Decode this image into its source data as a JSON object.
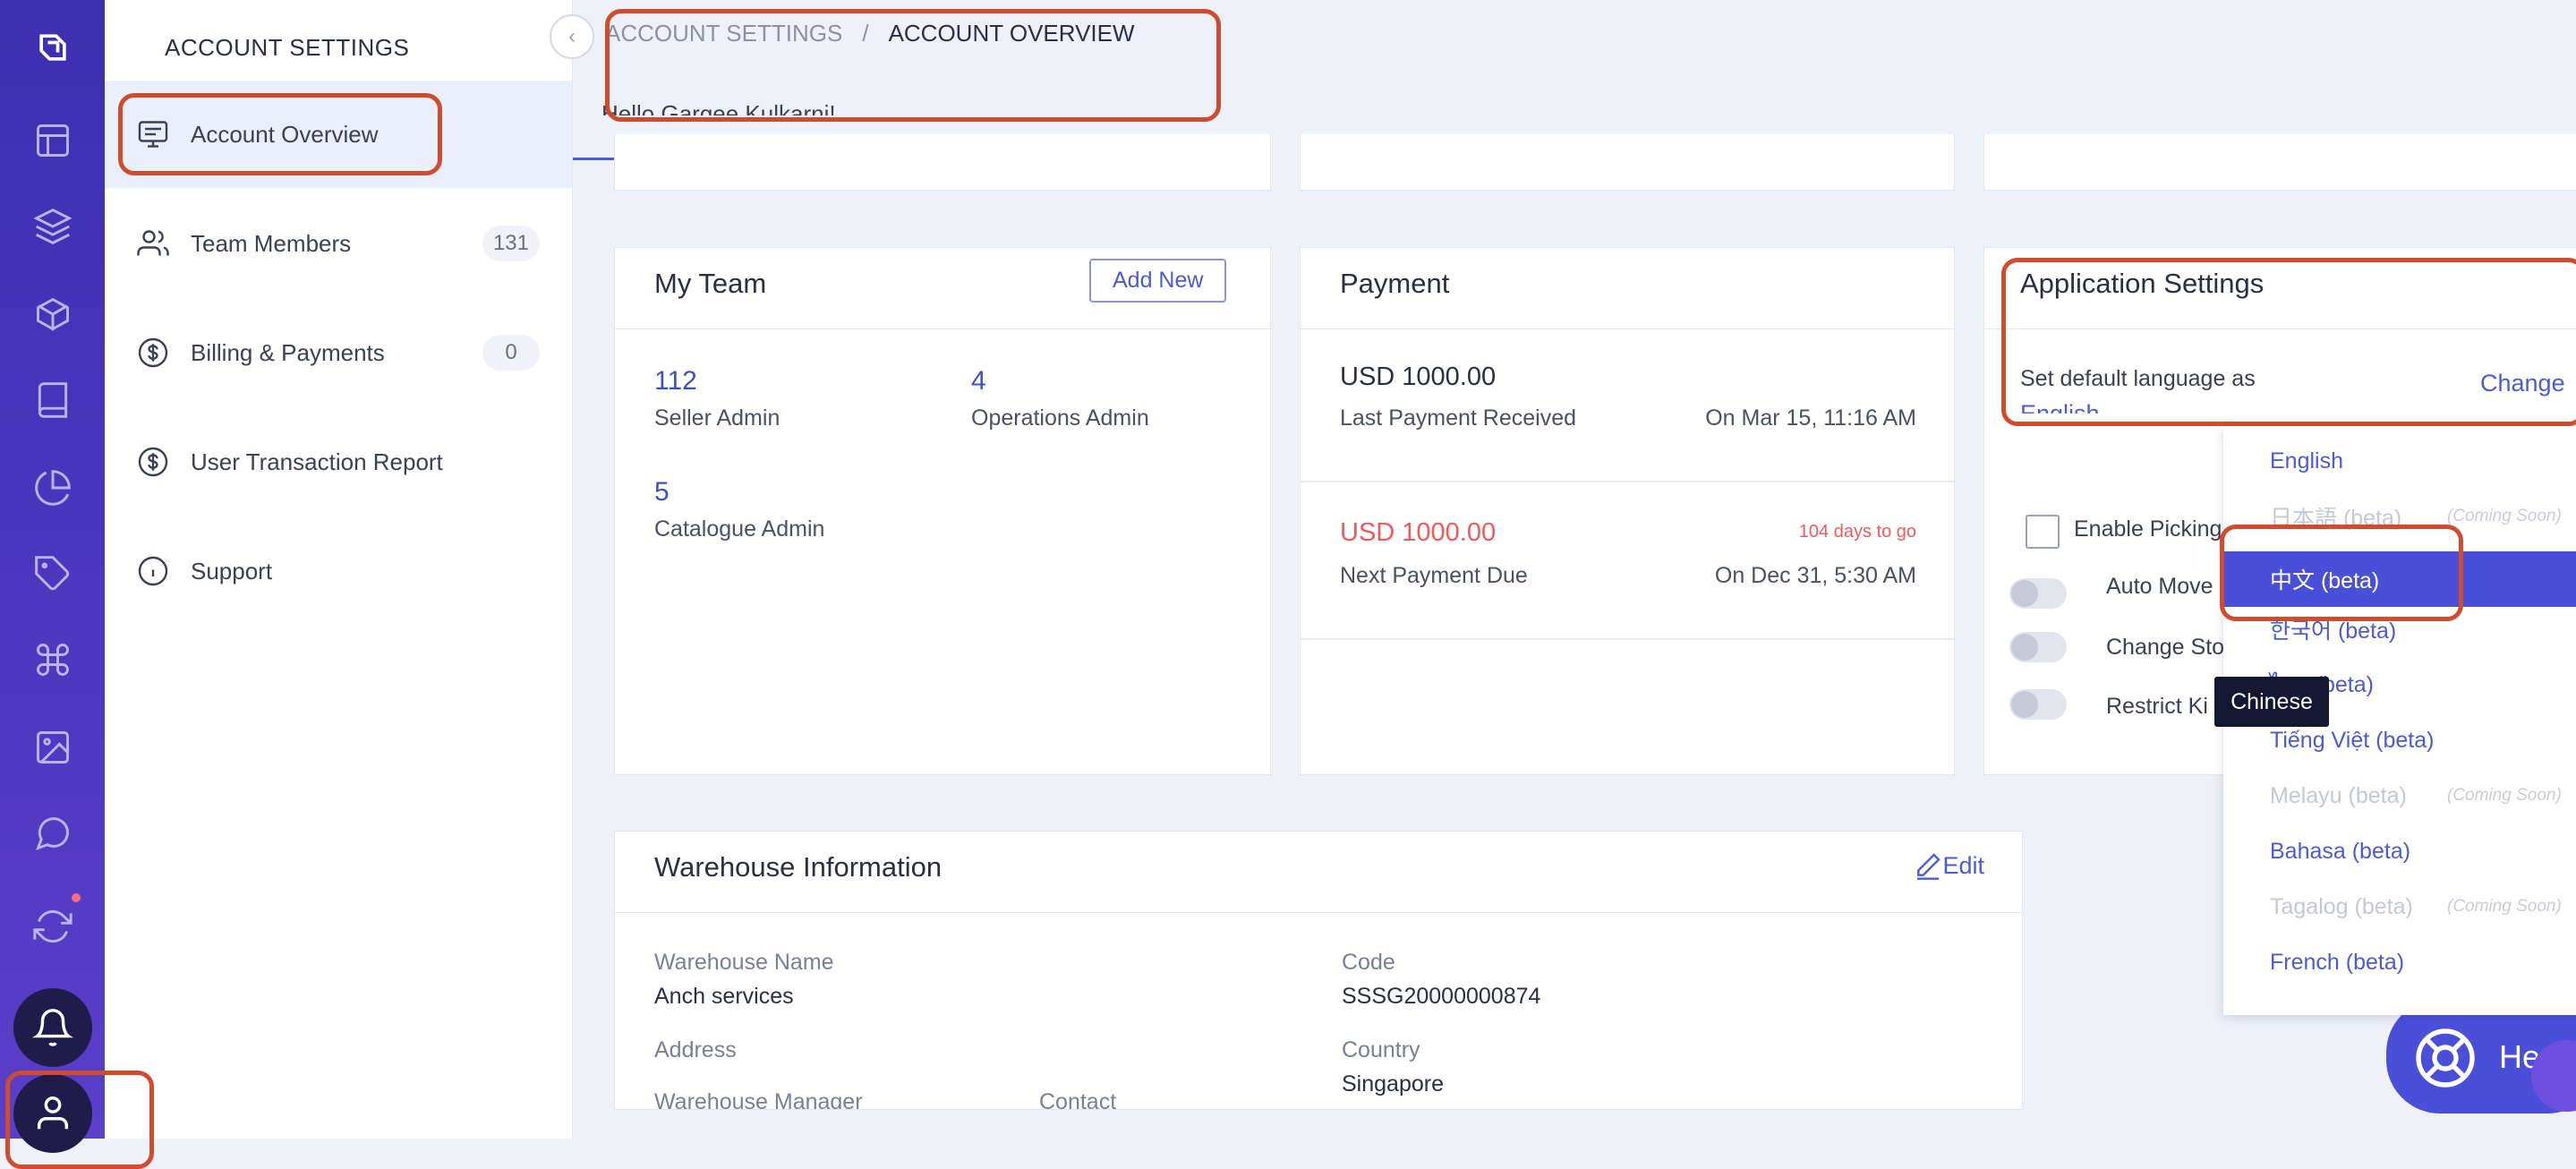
{
  "rail": {
    "icons": [
      "logo-icon",
      "layout-icon",
      "layers-icon",
      "box-icon",
      "book-icon",
      "pie-chart-icon",
      "tag-icon",
      "command-icon",
      "image-icon",
      "chat-icon",
      "sync-icon",
      "bell-icon",
      "user-icon"
    ]
  },
  "sidenav": {
    "heading": "ACCOUNT SETTINGS",
    "items": [
      {
        "label": "Account Overview",
        "icon": "monitor-icon",
        "active": true
      },
      {
        "label": "Team Members",
        "icon": "users-icon",
        "count": "131"
      },
      {
        "label": "Billing & Payments",
        "icon": "dollar-icon",
        "count": "0"
      },
      {
        "label": "User Transaction Report",
        "icon": "dollar-icon"
      },
      {
        "label": "Support",
        "icon": "info-icon"
      }
    ]
  },
  "header": {
    "breadcrumb": [
      "ACCOUNT SETTINGS",
      "/",
      "ACCOUNT OVERVIEW"
    ],
    "greeting": "Hello Gargee Kulkarni!"
  },
  "my_team": {
    "title": "My Team",
    "add_label": "Add New",
    "stats": [
      {
        "value": "112",
        "label": "Seller Admin"
      },
      {
        "value": "4",
        "label": "Operations Admin"
      },
      {
        "value": "5",
        "label": "Catalogue Admin"
      }
    ]
  },
  "payment": {
    "title": "Payment",
    "last": {
      "amount": "USD 1000.00",
      "label": "Last Payment Received",
      "date": "On Mar 15, 11:16 AM"
    },
    "next": {
      "amount": "USD 1000.00",
      "due_in": "104 days to go",
      "label": "Next Payment Due",
      "date": "On Dec 31, 5:30 AM"
    }
  },
  "app_settings": {
    "title": "Application Settings",
    "language_label": "Set default language as",
    "language_value": "English",
    "change_label": "Change",
    "options": [
      {
        "label": "Enable Picking",
        "type": "checkbox"
      },
      {
        "label": "Auto Move",
        "type": "toggle"
      },
      {
        "label": "Change Sto",
        "type": "toggle"
      },
      {
        "label": "Restrict Ki",
        "type": "toggle"
      }
    ]
  },
  "language_dropdown": {
    "items": [
      {
        "label": "English"
      },
      {
        "label": "日本語 (beta)",
        "soon": "(Coming Soon)",
        "disabled": true
      },
      {
        "label": "中文 (beta)",
        "selected": true
      },
      {
        "label": "한국어 (beta)"
      },
      {
        "label": "ไทย (beta)"
      },
      {
        "label": "Tiếng Việt (beta)"
      },
      {
        "label": "Melayu (beta)",
        "soon": "(Coming Soon)",
        "disabled": true
      },
      {
        "label": "Bahasa (beta)"
      },
      {
        "label": "Tagalog (beta)",
        "soon": "(Coming Soon)",
        "disabled": true
      },
      {
        "label": "French (beta)"
      }
    ],
    "tooltip": "Chinese"
  },
  "warehouse": {
    "title": "Warehouse Information",
    "edit_label": "Edit",
    "fields": {
      "name_key": "Warehouse Name",
      "name_val": "Anch services",
      "code_key": "Code",
      "code_val": "SSSG20000000874",
      "address_key": "Address",
      "country_key": "Country",
      "country_val": "Singapore",
      "manager_key": "Warehouse Manager",
      "contact_key": "Contact"
    }
  },
  "help": {
    "label": "He"
  },
  "colors": {
    "accent": "#4a4fd9",
    "rail": "#4a36bd",
    "danger": "#f05a5a",
    "annotation": "#cf4c2f"
  }
}
